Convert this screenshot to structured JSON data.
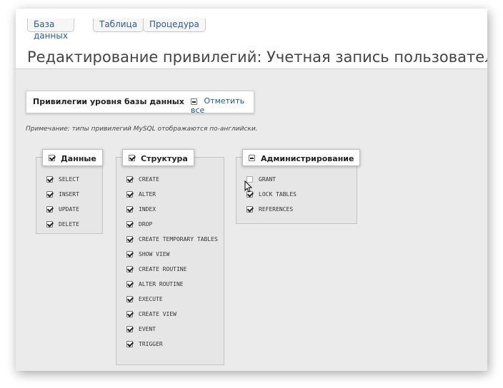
{
  "tabs": [
    {
      "label": "База данных"
    },
    {
      "label": "Таблица"
    },
    {
      "label": "Процедура"
    }
  ],
  "page_title": "Редактирование привилегий: Учетная запись пользователя '",
  "level": {
    "label": "Привилегии уровня базы данных",
    "check_all_label": "Отметить все"
  },
  "note": "Примечание: типы привилегий MySQL отображаются по-английски.",
  "groups": {
    "data": {
      "label": "Данные",
      "items": [
        {
          "label": "SELECT",
          "checked": true
        },
        {
          "label": "INSERT",
          "checked": true
        },
        {
          "label": "UPDATE",
          "checked": true
        },
        {
          "label": "DELETE",
          "checked": true
        }
      ]
    },
    "structure": {
      "label": "Структура",
      "items": [
        {
          "label": "CREATE",
          "checked": true
        },
        {
          "label": "ALTER",
          "checked": true
        },
        {
          "label": "INDEX",
          "checked": true
        },
        {
          "label": "DROP",
          "checked": true
        },
        {
          "label": "CREATE TEMPORARY TABLES",
          "checked": true
        },
        {
          "label": "SHOW VIEW",
          "checked": true
        },
        {
          "label": "CREATE ROUTINE",
          "checked": true
        },
        {
          "label": "ALTER ROUTINE",
          "checked": true
        },
        {
          "label": "EXECUTE",
          "checked": true
        },
        {
          "label": "CREATE VIEW",
          "checked": true
        },
        {
          "label": "EVENT",
          "checked": true
        },
        {
          "label": "TRIGGER",
          "checked": true
        }
      ]
    },
    "admin": {
      "label": "Администрирование",
      "items": [
        {
          "label": "GRANT",
          "checked": false
        },
        {
          "label": "LOCK TABLES",
          "checked": true
        },
        {
          "label": "REFERENCES",
          "checked": true
        }
      ]
    }
  }
}
